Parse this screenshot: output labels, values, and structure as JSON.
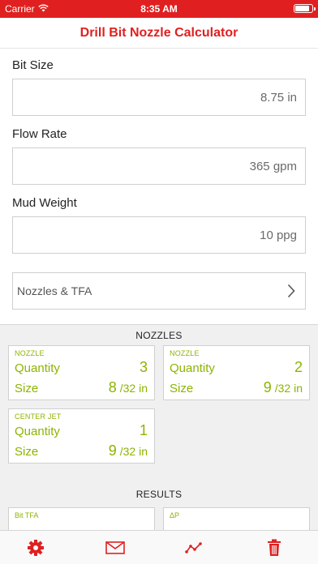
{
  "status_bar": {
    "carrier": "Carrier",
    "time": "8:35 AM"
  },
  "nav": {
    "title": "Drill Bit Nozzle Calculator"
  },
  "fields": {
    "bit_size": {
      "label": "Bit Size",
      "value": "8.75 in"
    },
    "flow_rate": {
      "label": "Flow Rate",
      "value": "365 gpm"
    },
    "mud_weight": {
      "label": "Mud Weight",
      "value": "10 ppg"
    }
  },
  "nozzles_link": {
    "label": "Nozzles & TFA"
  },
  "nozzles_section": {
    "title": "NOZZLES",
    "cards": [
      {
        "title": "NOZZLE",
        "quantity_label": "Quantity",
        "quantity": "3",
        "size_label": "Size",
        "size": "8",
        "unit": "/32 in"
      },
      {
        "title": "NOZZLE",
        "quantity_label": "Quantity",
        "quantity": "2",
        "size_label": "Size",
        "size": "9",
        "unit": "/32 in"
      },
      {
        "title": "CENTER JET",
        "quantity_label": "Quantity",
        "quantity": "1",
        "size_label": "Size",
        "size": "9",
        "unit": "/32 in"
      }
    ]
  },
  "results_section": {
    "title": "RESULTS",
    "cards": [
      {
        "title": "Bit TFA"
      },
      {
        "title": "ΔP"
      }
    ]
  },
  "tabbar": {
    "icons": [
      "gear-icon",
      "mail-icon",
      "chart-icon",
      "trash-icon"
    ]
  },
  "colors": {
    "brand_red": "#e02020",
    "accent_green": "#8cb400"
  }
}
